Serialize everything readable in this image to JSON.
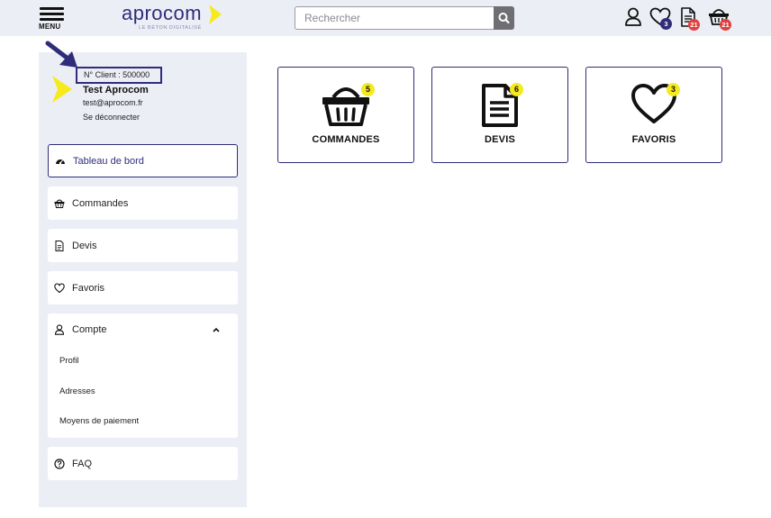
{
  "header": {
    "menu_label": "MENU",
    "logo_text": "aprocom",
    "logo_tagline": "LE BÉTON DIGITALISÉ",
    "search_placeholder": "Rechercher",
    "favorites_count": "3",
    "quotes_count": "21",
    "cart_count": "21",
    "colors": {
      "brand": "#2f2c7a",
      "accent": "#f5ea1d",
      "alert": "#e0403f"
    }
  },
  "account": {
    "client_number": "N° Client : 500000",
    "name": "Test Aprocom",
    "email": "test@aprocom.fr",
    "logout": "Se déconnecter"
  },
  "sidebar": {
    "dashboard": "Tableau de bord",
    "orders": "Commandes",
    "quotes": "Devis",
    "favorites": "Favoris",
    "account": "Compte",
    "account_items": [
      "Profil",
      "Adresses",
      "Moyens de paiement"
    ],
    "faq": "FAQ"
  },
  "cards": [
    {
      "label": "COMMANDES",
      "count": "5",
      "icon": "basket-icon"
    },
    {
      "label": "DEVIS",
      "count": "6",
      "icon": "document-icon"
    },
    {
      "label": "FAVORIS",
      "count": "3",
      "icon": "heart-icon"
    }
  ]
}
